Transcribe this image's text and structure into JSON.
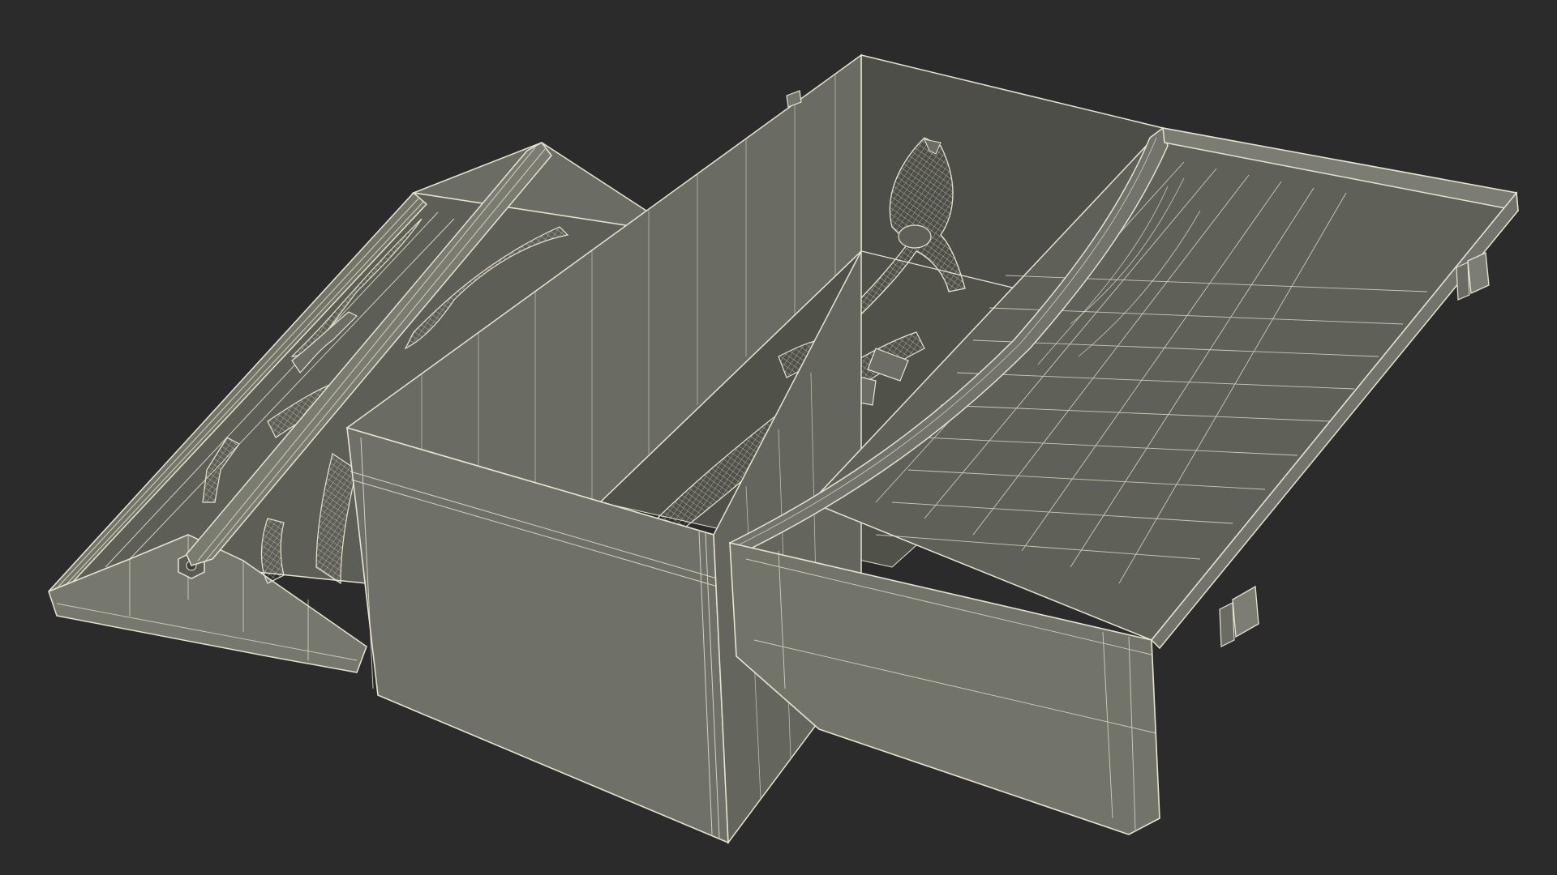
{
  "render": {
    "background": "#2b2b2b",
    "surface_fill": "#6f7067",
    "surface_fill_light": "#7a7b71",
    "surface_fill_dark": "#5c5d55",
    "inner_fill": "#555650",
    "wire_color": "#e6e3cf",
    "wire_faint": "#c9c6b1",
    "shadow": "#46473f"
  },
  "scene": {
    "subject": "toolbox-wireframe",
    "parts": [
      "left-lid-tray",
      "main-box",
      "right-lid",
      "pliers-clamp",
      "long-handle-tools",
      "tray-handle-bar",
      "latches"
    ]
  }
}
